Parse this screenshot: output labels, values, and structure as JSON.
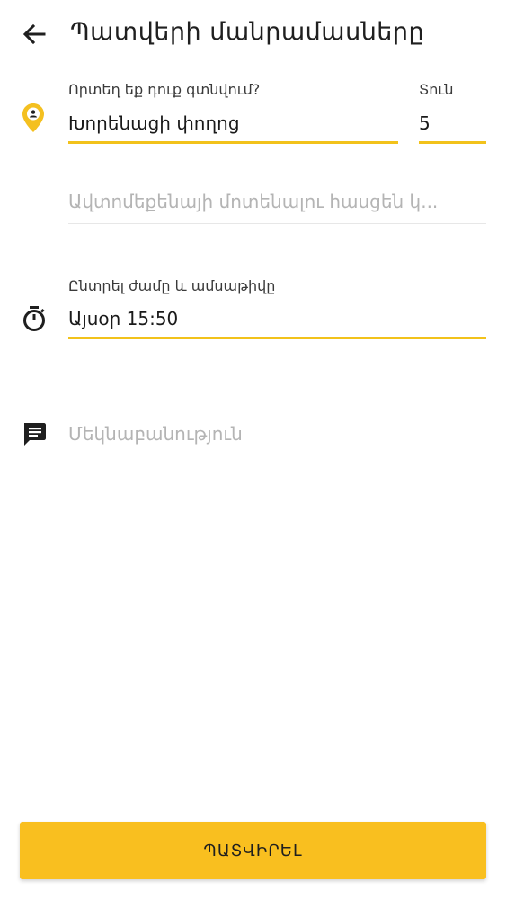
{
  "header": {
    "title": "Պատվերի մանրամասները",
    "back_icon": "arrow-left-icon"
  },
  "location": {
    "icon": "location-pin-icon",
    "label": "Որտեղ եք դուք գտնվում?",
    "value": "Խորենացի փողոց"
  },
  "house": {
    "label": "Տուն",
    "value": "5"
  },
  "car_address": {
    "placeholder": "Ավտոմեքենայի մոտենալու հասցեն կ..."
  },
  "time": {
    "icon": "timer-icon",
    "label": "Ընտրել ժամը և ամսաթիվը",
    "value": "Այսօր 15:50"
  },
  "comment": {
    "icon": "comment-icon",
    "placeholder": "Մեկնաբանություն"
  },
  "confirm_button": {
    "label": "ՊԱՏՎԻՐԵԼ"
  },
  "colors": {
    "accent": "#f9bf1f",
    "underline": "#f2c21b",
    "text": "#1f1f1f",
    "placeholder": "#b4b4b4"
  }
}
